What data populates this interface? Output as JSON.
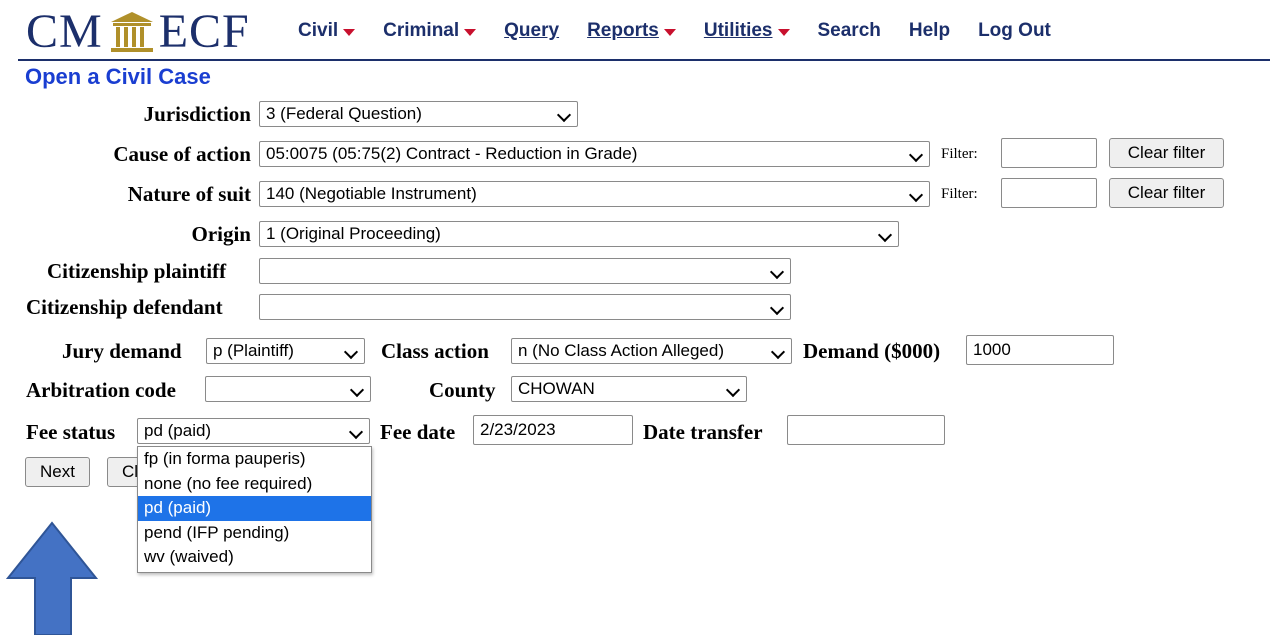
{
  "header": {
    "logo_left": "CM",
    "logo_right": "ECF",
    "menu": [
      {
        "label": "Civil",
        "has_caret": true
      },
      {
        "label": "Criminal",
        "has_caret": true
      },
      {
        "label": "Query",
        "has_caret": false
      },
      {
        "label": "Reports",
        "has_caret": true
      },
      {
        "label": "Utilities",
        "has_caret": true
      },
      {
        "label": "Search",
        "has_caret": false
      },
      {
        "label": "Help",
        "has_caret": false
      },
      {
        "label": "Log Out",
        "has_caret": false
      }
    ]
  },
  "page_title": "Open a Civil Case",
  "form": {
    "jurisdiction": {
      "label": "Jurisdiction",
      "value": "3 (Federal Question)"
    },
    "cause_of_action": {
      "label": "Cause of action",
      "value": "05:0075 (05:75(2) Contract - Reduction in Grade)"
    },
    "nature_of_suit": {
      "label": "Nature of suit",
      "value": "140 (Negotiable Instrument)"
    },
    "filter_label": "Filter:",
    "clear_filter_label": "Clear filter",
    "origin": {
      "label": "Origin",
      "value": "1 (Original Proceeding)"
    },
    "citizenship_plaintiff": {
      "label": "Citizenship plaintiff",
      "value": ""
    },
    "citizenship_defendant": {
      "label": "Citizenship defendant",
      "value": ""
    },
    "jury_demand": {
      "label": "Jury demand",
      "value": "p (Plaintiff)"
    },
    "class_action": {
      "label": "Class action",
      "value": "n (No Class Action Alleged)"
    },
    "demand": {
      "label": "Demand ($000)",
      "value": "1000"
    },
    "arbitration_code": {
      "label": "Arbitration code",
      "value": ""
    },
    "county": {
      "label": "County",
      "value": "CHOWAN"
    },
    "fee_status": {
      "label": "Fee status",
      "value": "pd (paid)",
      "options": [
        "fp (in forma pauperis)",
        "none (no fee required)",
        "pd (paid)",
        "pend (IFP pending)",
        "wv (waived)"
      ],
      "selected_index": 2
    },
    "fee_date": {
      "label": "Fee date",
      "value": "2/23/2023"
    },
    "date_transfer": {
      "label": "Date transfer",
      "value": ""
    }
  },
  "buttons": {
    "next": "Next",
    "clear": "Cl"
  },
  "colors": {
    "brand": "#1c2f6b",
    "title": "#1a3ed1",
    "caret": "#c8102e",
    "selected_option": "#1e73e8",
    "arrow": "#4472c4"
  }
}
